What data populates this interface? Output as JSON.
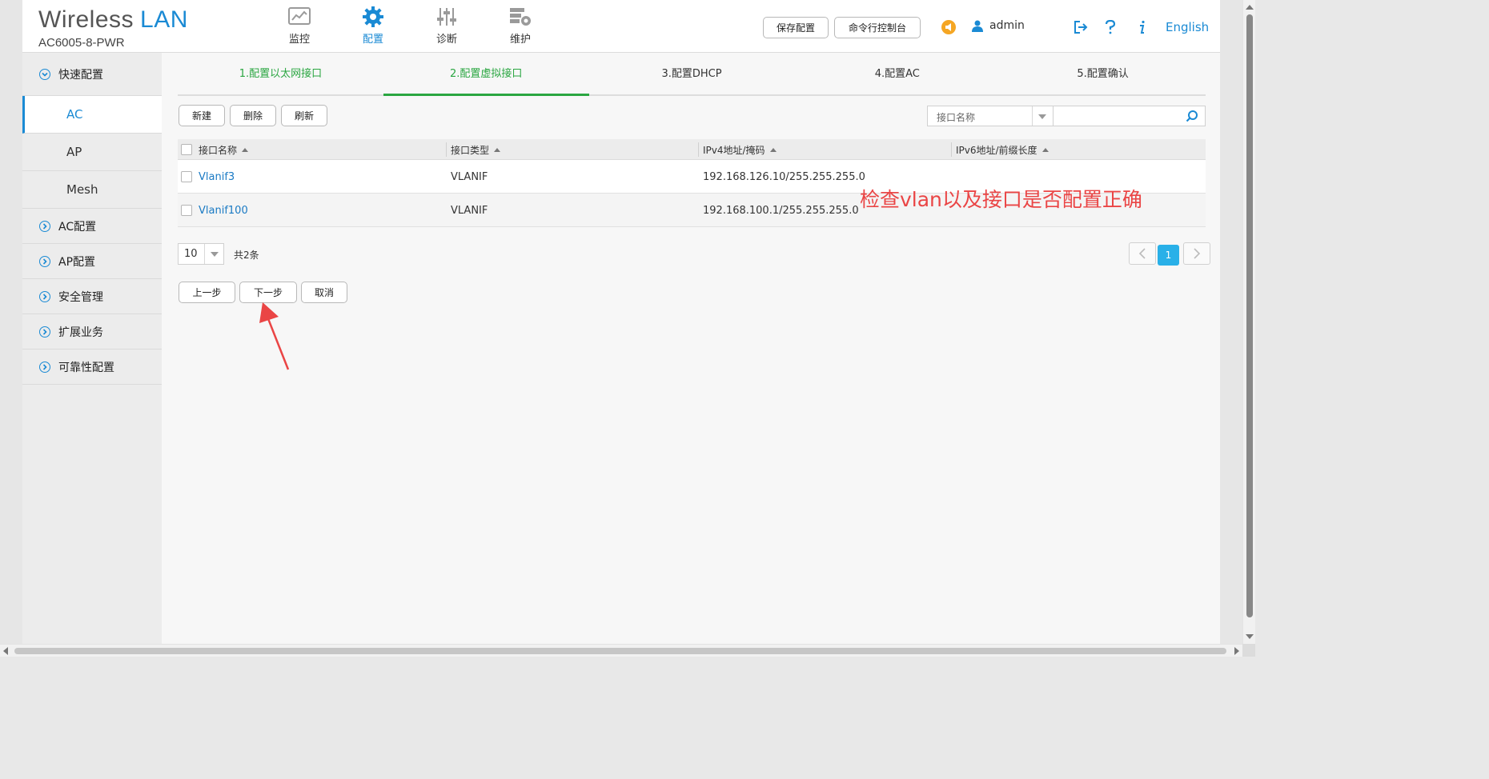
{
  "app": {
    "brand_primary": "Wireless",
    "brand_accent": "LAN",
    "model": "AC6005-8-PWR"
  },
  "colors": {
    "accent_blue": "#1a8ad4",
    "step_green": "#2aa641",
    "annotation_red": "#ea4545",
    "page_active": "#29b0e8",
    "bell_orange": "#f5a623"
  },
  "topnav": [
    {
      "label": "监控",
      "icon": "monitor-icon",
      "active": false
    },
    {
      "label": "配置",
      "icon": "gear-icon",
      "active": true
    },
    {
      "label": "诊断",
      "icon": "sliders-icon",
      "active": false
    },
    {
      "label": "维护",
      "icon": "maintenance-icon",
      "active": false
    }
  ],
  "header": {
    "save_config": "保存配置",
    "cli_console": "命令行控制台",
    "user": "admin",
    "language": "English",
    "icons": [
      "announcement-icon",
      "user-icon",
      "logout-icon",
      "help-icon",
      "info-icon"
    ]
  },
  "sidebar": {
    "groups": [
      {
        "label": "快速配置",
        "expanded": true
      },
      {
        "label": "AC配置",
        "expanded": false
      },
      {
        "label": "AP配置",
        "expanded": false
      },
      {
        "label": "安全管理",
        "expanded": false
      },
      {
        "label": "扩展业务",
        "expanded": false
      },
      {
        "label": "可靠性配置",
        "expanded": false
      }
    ],
    "quick_items": [
      {
        "label": "AC",
        "active": true
      },
      {
        "label": "AP",
        "active": false
      },
      {
        "label": "Mesh",
        "active": false
      }
    ]
  },
  "steps": [
    {
      "label": "1.配置以太网接口",
      "state": "done"
    },
    {
      "label": "2.配置虚拟接口",
      "state": "active"
    },
    {
      "label": "3.配置DHCP",
      "state": "todo"
    },
    {
      "label": "4.配置AC",
      "state": "todo"
    },
    {
      "label": "5.配置确认",
      "state": "todo"
    }
  ],
  "toolbar": {
    "new": "新建",
    "delete": "删除",
    "refresh": "刷新"
  },
  "filter": {
    "field": "接口名称",
    "value": ""
  },
  "table": {
    "columns": [
      "接口名称",
      "接口类型",
      "IPv4地址/掩码",
      "IPv6地址/前缀长度"
    ],
    "rows": [
      {
        "name": "Vlanif3",
        "type": "VLANIF",
        "ipv4": "192.168.126.10/255.255.255.0",
        "ipv6": ""
      },
      {
        "name": "Vlanif100",
        "type": "VLANIF",
        "ipv4": "192.168.100.1/255.255.255.0",
        "ipv6": ""
      }
    ]
  },
  "pagination": {
    "page_size": "10",
    "total": "共2条",
    "current_page": "1"
  },
  "wizard": {
    "prev": "上一步",
    "next": "下一步",
    "cancel": "取消"
  },
  "annotation": {
    "text": "检查vlan以及接口是否配置正确"
  }
}
